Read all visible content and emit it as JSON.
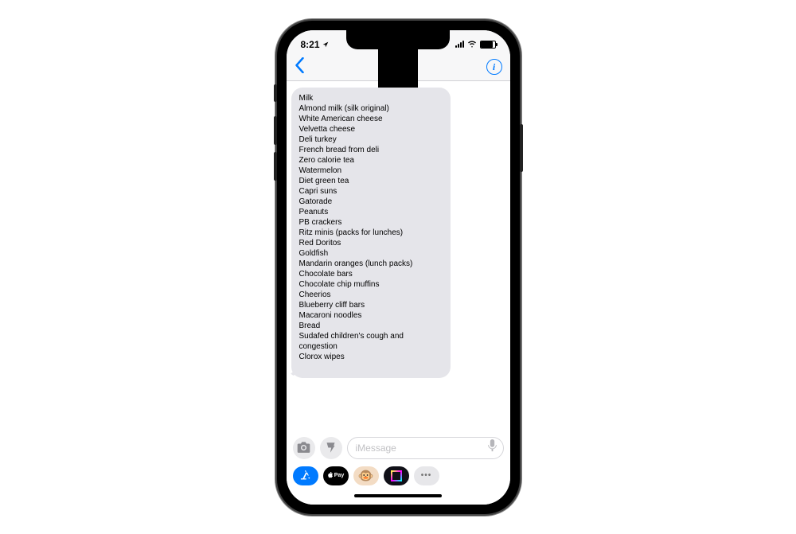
{
  "statusBar": {
    "time": "8:21",
    "locationActive": true
  },
  "message": {
    "items": [
      "Milk",
      "Almond milk (silk original)",
      "White American cheese",
      "Velvetta cheese",
      "Deli turkey",
      "French bread from deli",
      "Zero calorie tea",
      "Watermelon",
      "Diet green tea",
      "Capri suns",
      "Gatorade",
      "Peanuts",
      "PB crackers",
      "Ritz minis (packs for lunches)",
      "Red Doritos",
      "Goldfish",
      "Mandarin oranges (lunch packs)",
      "Chocolate bars",
      "Chocolate chip muffins",
      "Cheerios",
      "Blueberry cliff bars",
      "Macaroni noodles",
      "Bread",
      "Sudafed children's cough and congestion",
      "Clorox wipes"
    ]
  },
  "compose": {
    "placeholder": "iMessage"
  },
  "applePay": {
    "label": "Pay"
  },
  "more": {
    "label": "•••"
  }
}
